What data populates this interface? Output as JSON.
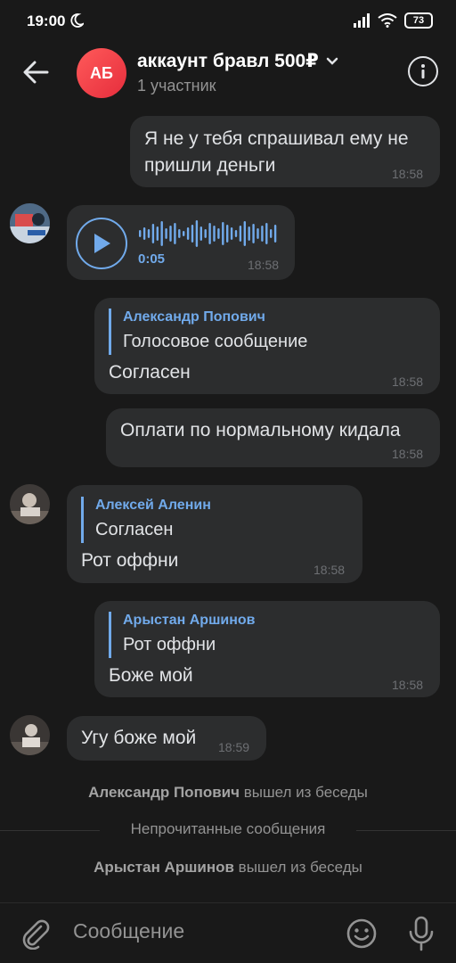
{
  "status": {
    "time": "19:00",
    "battery": "73"
  },
  "header": {
    "avatar_initials": "АБ",
    "title": "аккаунт бравл 500₽",
    "subtitle": "1 участник"
  },
  "messages": [
    {
      "line1": "Я не у тебя спрашивал ему не",
      "line2": "пришли деньги",
      "time": "18:58"
    },
    {
      "duration": "0:05",
      "time": "18:58"
    },
    {
      "reply_name": "Александр Попович",
      "reply_text": "Голосовое сообщение",
      "text": "Согласен",
      "time": "18:58"
    },
    {
      "text": "Оплати по нормальному кидала",
      "time": "18:58"
    },
    {
      "reply_name": "Алексей Аленин",
      "reply_text": "Согласен",
      "text": "Рот оффни",
      "time": "18:58"
    },
    {
      "reply_name": "Арыстан Аршинов",
      "reply_text": "Рот оффни",
      "text": "Боже мой",
      "time": "18:58"
    },
    {
      "text": "Угу боже мой",
      "time": "18:59"
    }
  ],
  "service": {
    "left1_name": "Александр Попович",
    "left1_action": " вышел из беседы",
    "unread": "Непрочитанные сообщения",
    "left2_name": "Арыстан Аршинов",
    "left2_action": " вышел из беседы"
  },
  "composer": {
    "placeholder": "Сообщение"
  },
  "icons": {
    "back": "arrow-left-icon",
    "info": "info-icon",
    "chevron": "chevron-down-icon",
    "play": "play-icon",
    "attach": "paperclip-icon",
    "emoji": "smile-icon",
    "mic": "microphone-icon"
  },
  "colors": {
    "background": "#191919",
    "bubble": "#2c2d2e",
    "accent": "#71aaeb",
    "avatar": "#e62d3c"
  }
}
